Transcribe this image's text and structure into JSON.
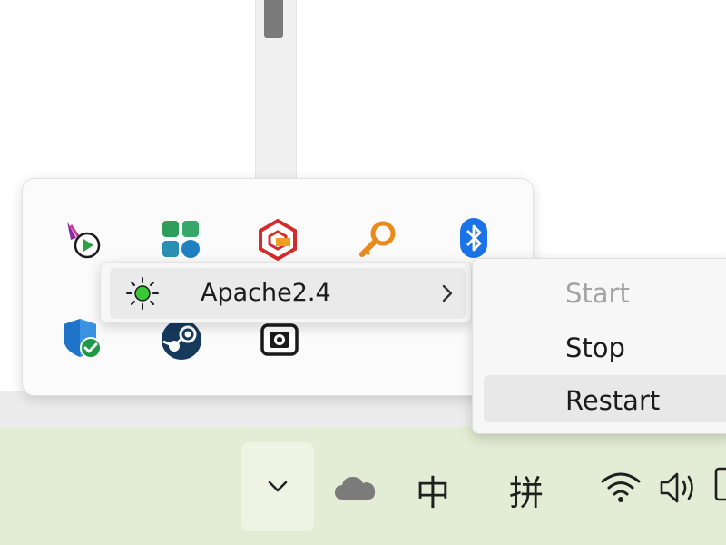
{
  "flyout": {
    "icons": [
      {
        "name": "media-player-tray-icon"
      },
      {
        "name": "app-tiles-tray-icon"
      },
      {
        "name": "phpstudy-tray-icon"
      },
      {
        "name": "key-tray-icon"
      },
      {
        "name": "bluetooth-icon"
      },
      {
        "name": "windows-security-icon"
      },
      {
        "name": "steam-icon"
      },
      {
        "name": "screenshot-tool-tray-icon"
      }
    ]
  },
  "context_menu": {
    "service_label": "Apache2.4",
    "submenu": {
      "start_label": "Start",
      "stop_label": "Stop",
      "restart_label": "Restart"
    }
  },
  "taskbar": {
    "ime_mode": "中",
    "ime_pinyin": "拼"
  },
  "colors": {
    "taskbar_bg": "#e3ecd4",
    "flyout_bg": "#fbfbfb",
    "menu_bg": "#f7f7f7",
    "disabled_text": "#a3a3a3",
    "bluetooth_blue": "#1a73e8",
    "key_orange": "#e98a1a"
  }
}
